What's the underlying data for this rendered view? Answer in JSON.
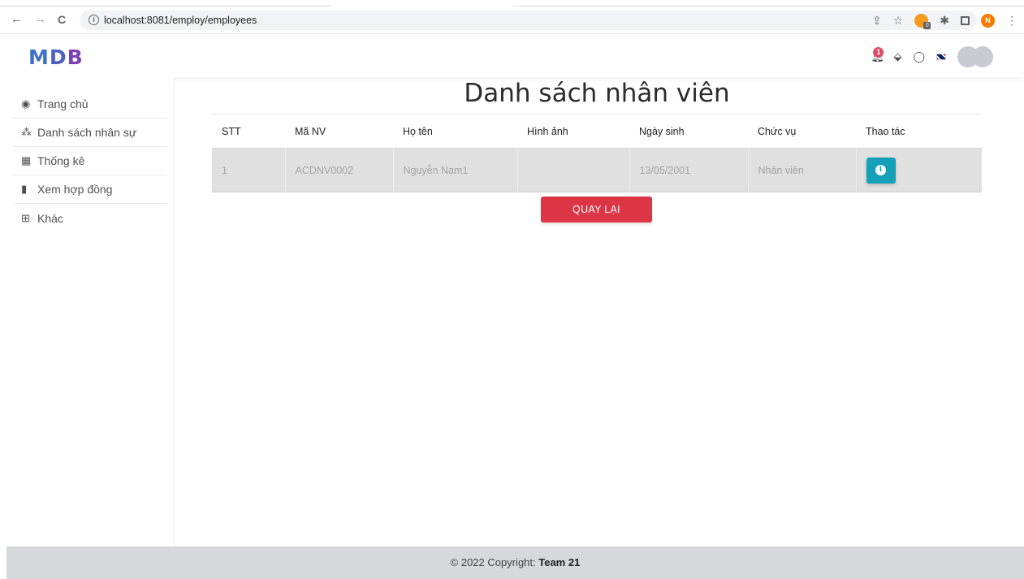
{
  "browser": {
    "url": "localhost:8081/employ/employees",
    "back_icon": "←",
    "forward_icon": "→",
    "reload_icon": "C",
    "info_icon": "i",
    "profile_initial": "N",
    "extension_badge": "0"
  },
  "navbar": {
    "logo_m": "M",
    "logo_d": "D",
    "logo_b": "B",
    "notification_count": "1"
  },
  "sidebar": {
    "items": [
      {
        "label": "Trang chủ",
        "icon": "tachometer-icon",
        "glyph": "◉"
      },
      {
        "label": "Danh sách nhân sự",
        "icon": "users-icon",
        "glyph": "⁂"
      },
      {
        "label": "Thống kê",
        "icon": "calendar-icon",
        "glyph": "▦"
      },
      {
        "label": "Xem hợp đồng",
        "icon": "file-icon",
        "glyph": "▮"
      },
      {
        "label": "Khác",
        "icon": "grid-icon",
        "glyph": "⊞"
      }
    ]
  },
  "main": {
    "title": "Danh sách nhân viên",
    "table": {
      "headers": [
        "STT",
        "Mã NV",
        "Họ tên",
        "Hình ảnh",
        "Ngày sinh",
        "Chức vụ",
        "Thao tác"
      ],
      "rows": [
        {
          "stt": "1",
          "ma_nv": "ACDNV0002",
          "ho_ten": "Nguyễn Nam1",
          "hinh_anh": "",
          "ngay_sinh": "13/05/2001",
          "chuc_vu": "Nhân viên",
          "action_glyph": "i"
        }
      ]
    },
    "back_label": "QUAY LẠI"
  },
  "footer": {
    "prefix": "© 2022 Copyright: ",
    "team": "Team 21"
  },
  "colors": {
    "danger": "#dc3545",
    "info": "#14a0b8",
    "footer_bg": "#d7d8da",
    "row_bg": "#e0e0e0"
  }
}
